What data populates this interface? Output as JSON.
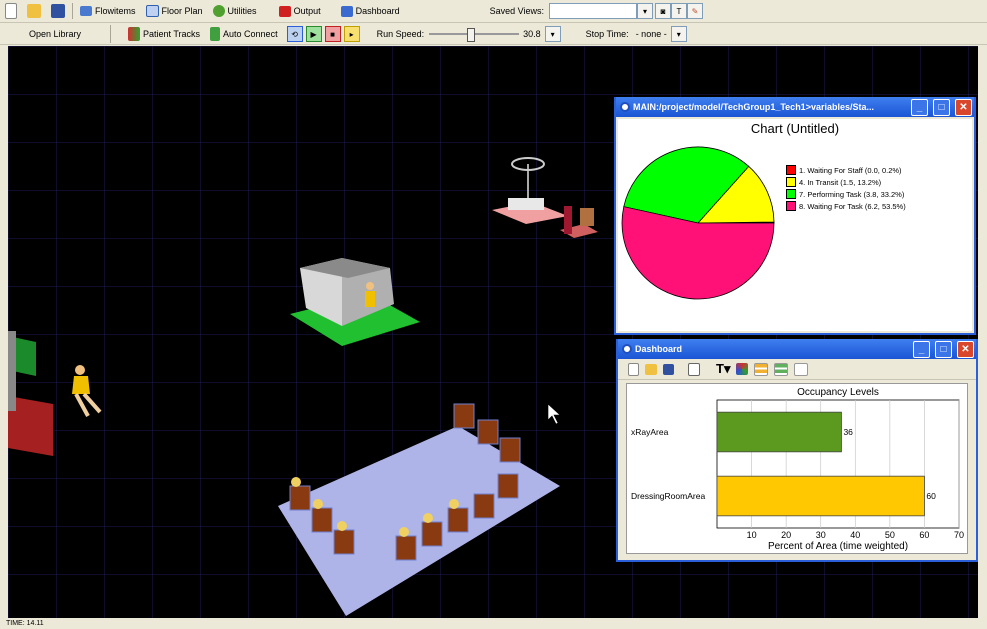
{
  "toolbar1": {
    "flowitems": "Flowitems",
    "floor_plan": "Floor Plan",
    "utilities": "Utilities",
    "output": "Output",
    "dashboard": "Dashboard",
    "saved_views_label": "Saved Views:"
  },
  "toolbar2": {
    "open_library": "Open Library",
    "patient_tracks": "Patient Tracks",
    "auto_connect": "Auto Connect",
    "run_speed_label": "Run Speed:",
    "run_speed_value": "30.8",
    "stop_time_label": "Stop Time:",
    "stop_time_value": "- none -"
  },
  "status": {
    "time": "TIME: 14.11"
  },
  "chart_window": {
    "title": "MAIN:/project/model/TechGroup1_Tech1>variables/Sta...",
    "chart_title": "Chart (Untitled)"
  },
  "dashboard_window": {
    "title": "Dashboard"
  },
  "colors": {
    "waiting_staff": "#ff0000",
    "in_transit": "#ffff00",
    "performing": "#00ff00",
    "waiting_task": "#ff1177",
    "xray": "#5b9a1f",
    "dressing": "#ffc800"
  },
  "chart_data": [
    {
      "type": "pie",
      "title": "Chart (Untitled)",
      "labels": [
        "1. Waiting For Staff (0.0, 0.2%)",
        "4. In Transit (1.5, 13.2%)",
        "7. Performing Task (3.8, 33.2%)",
        "8. Waiting For Task (6.2, 53.5%)"
      ],
      "values": [
        0.2,
        13.2,
        33.2,
        53.5
      ],
      "colors": [
        "#ff0000",
        "#ffff00",
        "#00ff00",
        "#ff1177"
      ],
      "legend": "right"
    },
    {
      "type": "bar",
      "orientation": "horizontal",
      "title": "Occupancy Levels",
      "categories": [
        "xRayArea",
        "DressingRoomArea"
      ],
      "values": [
        36,
        60
      ],
      "value_labels": [
        "36",
        "60"
      ],
      "colors": [
        "#5b9a1f",
        "#ffc800"
      ],
      "xlabel": "Percent of Area (time weighted)",
      "xlim": [
        0,
        70
      ],
      "xticks": [
        "10",
        "20",
        "30",
        "40",
        "50",
        "60",
        "70"
      ],
      "grid": true
    }
  ]
}
